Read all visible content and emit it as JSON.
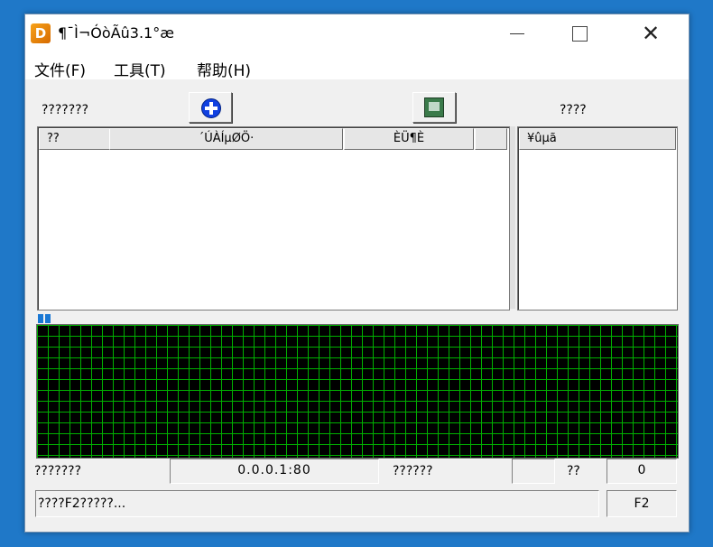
{
  "window": {
    "title": "¶¯Ì¬ÓòÃû3.1°æ",
    "icon_letter": "D",
    "controls": {
      "minimize": "minimize-icon",
      "maximize": "maximize-icon",
      "close": "✕"
    }
  },
  "menu": {
    "items": [
      {
        "label": "文件(F)"
      },
      {
        "label": "工具(T)"
      },
      {
        "label": "帮助(H)"
      }
    ]
  },
  "toolbar": {
    "left_label": "???????",
    "right_label": "????",
    "add_button_icon": "plus-circle-icon",
    "config_button_icon": "settings-icon"
  },
  "list_main": {
    "columns": [
      "??",
      "´ÚÀÍµØÖ·",
      "ÈÜ¶È",
      ""
    ]
  },
  "list_side": {
    "columns": [
      "¥ûµã"
    ]
  },
  "graph": {
    "grid_color": "#00b000",
    "background": "#000000"
  },
  "status": {
    "label1": "???????",
    "address": "0.0.0.1:80",
    "label2": "??????",
    "field_empty": "",
    "label3": "??",
    "count": "0",
    "message": "????F2?????...",
    "key": "F2"
  }
}
